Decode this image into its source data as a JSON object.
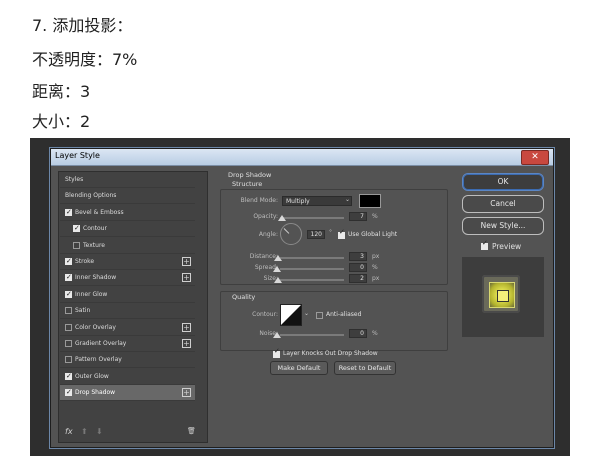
{
  "instructions": {
    "step": "7. 添加投影：",
    "opacity": "不透明度：7%",
    "distance": "距离：3",
    "size": "大小：2"
  },
  "dialog": {
    "title": "Layer Style",
    "close_symbol": "✕"
  },
  "styles_list": [
    {
      "label": "Styles",
      "checkbox": null,
      "plus": false,
      "selected": false,
      "indent": 0
    },
    {
      "label": "Blending Options",
      "checkbox": null,
      "plus": false,
      "selected": false,
      "indent": 0
    },
    {
      "label": "Bevel & Emboss",
      "checkbox": true,
      "plus": false,
      "selected": false,
      "indent": 0
    },
    {
      "label": "Contour",
      "checkbox": true,
      "plus": false,
      "selected": false,
      "indent": 1
    },
    {
      "label": "Texture",
      "checkbox": false,
      "plus": false,
      "selected": false,
      "indent": 1
    },
    {
      "label": "Stroke",
      "checkbox": true,
      "plus": true,
      "selected": false,
      "indent": 0
    },
    {
      "label": "Inner Shadow",
      "checkbox": true,
      "plus": true,
      "selected": false,
      "indent": 0
    },
    {
      "label": "Inner Glow",
      "checkbox": true,
      "plus": false,
      "selected": false,
      "indent": 0
    },
    {
      "label": "Satin",
      "checkbox": false,
      "plus": false,
      "selected": false,
      "indent": 0
    },
    {
      "label": "Color Overlay",
      "checkbox": false,
      "plus": true,
      "selected": false,
      "indent": 0
    },
    {
      "label": "Gradient Overlay",
      "checkbox": false,
      "plus": true,
      "selected": false,
      "indent": 0
    },
    {
      "label": "Pattern Overlay",
      "checkbox": false,
      "plus": false,
      "selected": false,
      "indent": 0
    },
    {
      "label": "Outer Glow",
      "checkbox": true,
      "plus": false,
      "selected": false,
      "indent": 0
    },
    {
      "label": "Drop Shadow",
      "checkbox": true,
      "plus": true,
      "selected": true,
      "indent": 0
    }
  ],
  "footer_icons": {
    "fx": "fx",
    "up": "⬆",
    "down": "⬇",
    "trash": "🗑"
  },
  "drop_shadow": {
    "title": "Drop Shadow",
    "structure_title": "Structure",
    "blend_mode_label": "Blend Mode:",
    "blend_mode_value": "Multiply",
    "shadow_color": "#000000",
    "opacity_label": "Opacity:",
    "opacity_value": "7",
    "opacity_unit": "%",
    "angle_label": "Angle:",
    "angle_value": "120",
    "angle_unit": "°",
    "use_global_light_label": "Use Global Light",
    "distance_label": "Distance:",
    "distance_value": "3",
    "distance_unit": "px",
    "spread_label": "Spread:",
    "spread_value": "0",
    "spread_unit": "%",
    "size_label": "Size:",
    "size_value": "2",
    "size_unit": "px",
    "quality_title": "Quality",
    "contour_label": "Contour:",
    "anti_aliased_label": "Anti-aliased",
    "noise_label": "Noise:",
    "noise_value": "0",
    "noise_unit": "%",
    "layer_knocks_label": "Layer Knocks Out Drop Shadow",
    "make_default_label": "Make Default",
    "reset_default_label": "Reset to Default"
  },
  "buttons": {
    "ok": "OK",
    "cancel": "Cancel",
    "new_style": "New Style...",
    "preview_label": "Preview"
  }
}
